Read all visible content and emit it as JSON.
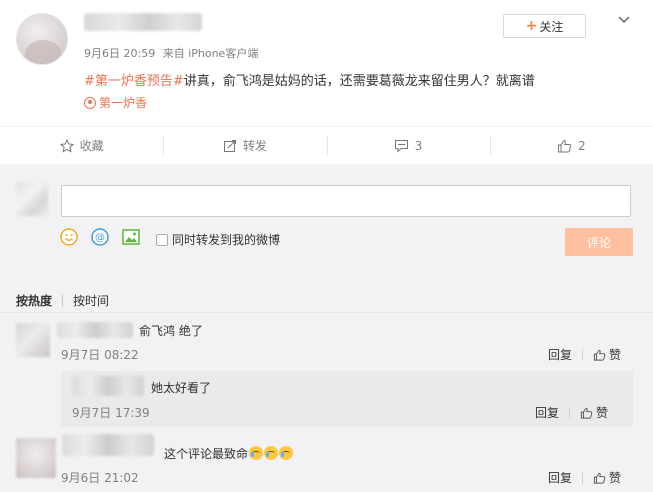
{
  "post": {
    "follow_label": "关注",
    "date": "9月6日 20:59",
    "source": "来自 iPhone客户端",
    "hashtag": "#第一炉香预告#",
    "text": "讲真，俞飞鸿是姑妈的话，还需要葛薇龙来留住男人？就离谱",
    "topic_link": "第一炉香"
  },
  "actions": {
    "favorite_label": "收藏",
    "repost_label": "转发",
    "comment_count": "3",
    "like_count": "2"
  },
  "composer": {
    "input_value": "",
    "repost_label": "同时转发到我的微博",
    "submit_label": "评论"
  },
  "sort": {
    "hot_label": "按热度",
    "time_label": "按时间"
  },
  "comments": [
    {
      "text": "俞飞鸿 绝了",
      "time": "9月7日 08:22",
      "reply_label": "回复",
      "like_label": "赞"
    },
    {
      "text": "她太好看了",
      "time": "9月7日 17:39",
      "reply_label": "回复",
      "like_label": "赞"
    },
    {
      "text": "这个评论最致命",
      "time": "9月6日 21:02",
      "reply_label": "回复",
      "like_label": "赞"
    }
  ],
  "colors": {
    "accent": "#eb7350",
    "submit_bg": "#ffc09f",
    "comment_bg": "#f2f2f5"
  }
}
